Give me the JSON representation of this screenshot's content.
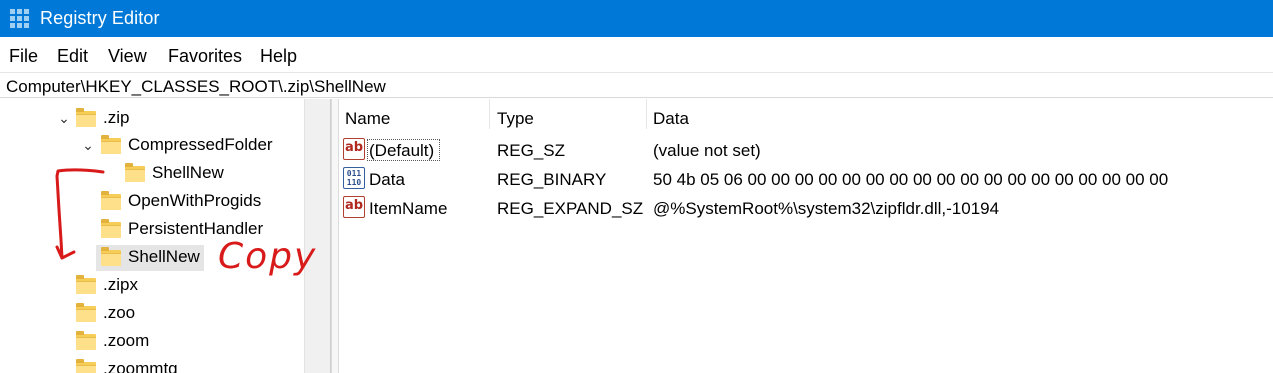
{
  "window": {
    "title": "Registry Editor",
    "icon": "registry-editor-icon"
  },
  "menu": [
    "File",
    "Edit",
    "View",
    "Favorites",
    "Help"
  ],
  "address": "Computer\\HKEY_CLASSES_ROOT\\.zip\\ShellNew",
  "tree": {
    "items": [
      {
        "label": ".zip",
        "expanded": true,
        "chevron": "⌄"
      },
      {
        "label": "CompressedFolder",
        "expanded": true,
        "chevron": "⌄"
      },
      {
        "label": "ShellNew"
      },
      {
        "label": "OpenWithProgids"
      },
      {
        "label": "PersistentHandler"
      },
      {
        "label": "ShellNew",
        "selected": true
      },
      {
        "label": ".zipx"
      },
      {
        "label": ".zoo"
      },
      {
        "label": ".zoom"
      },
      {
        "label": ".zoommtg"
      }
    ]
  },
  "list": {
    "columns": [
      "Name",
      "Type",
      "Data"
    ],
    "rows": [
      {
        "name": "(Default)",
        "type": "REG_SZ",
        "data": "(value not set)",
        "icon": "string-value-icon"
      },
      {
        "name": "Data",
        "type": "REG_BINARY",
        "data": "50 4b 05 06 00 00 00 00 00 00 00 00 00 00 00 00 00 00 00 00 00 00",
        "icon": "binary-value-icon"
      },
      {
        "name": "ItemName",
        "type": "REG_EXPAND_SZ",
        "data": "@%SystemRoot%\\system32\\zipfldr.dll,-10194",
        "icon": "string-value-icon"
      }
    ],
    "icon_text": {
      "string": "ab",
      "binary": "011 110"
    }
  },
  "annotation": {
    "text": "Copy",
    "color": "#d81a1a"
  },
  "colors": {
    "titlebar": "#0078d7",
    "folder": "#f6cd56",
    "selection": "#e5e5e5"
  }
}
